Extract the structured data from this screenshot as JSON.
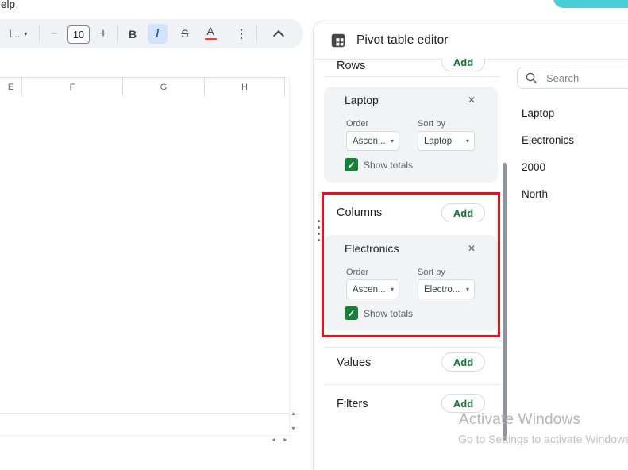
{
  "menubar": {
    "help_fragment": "elp"
  },
  "toolbar": {
    "font_family_value": "l...",
    "decrease_icon": "−",
    "font_size_value": "10",
    "increase_icon": "+",
    "bold_label": "B",
    "italic_label": "I",
    "strikethrough_label": "S",
    "text_color_label": "A"
  },
  "icons": {
    "caret": "▾",
    "close": "✕",
    "check": "✓",
    "more_vertical": "⋮",
    "arrow_up": "▲",
    "arrow_down": "▼",
    "arrow_left": "◄",
    "arrow_right": "►"
  },
  "sheet": {
    "column_headers": [
      "E",
      "F",
      "G",
      "H"
    ]
  },
  "pivot": {
    "title": "Pivot table editor",
    "rows": {
      "label": "Rows",
      "add_label": "Add"
    },
    "columns": {
      "label": "Columns",
      "add_label": "Add"
    },
    "values": {
      "label": "Values",
      "add_label": "Add"
    },
    "filters": {
      "label": "Filters",
      "add_label": "Add"
    },
    "rows_card": {
      "title": "Laptop",
      "order_label": "Order",
      "order_value": "Ascen...",
      "sortby_label": "Sort by",
      "sortby_value": "Laptop",
      "show_totals_label": "Show totals",
      "show_totals_checked": true
    },
    "columns_card": {
      "title": "Electronics",
      "order_label": "Order",
      "order_value": "Ascen...",
      "sortby_label": "Sort by",
      "sortby_value": "Electro...",
      "show_totals_label": "Show totals",
      "show_totals_checked": true
    }
  },
  "fields": {
    "search_placeholder": "Search",
    "items": [
      "Laptop",
      "Electronics",
      "2000",
      "North"
    ]
  },
  "watermark": {
    "line1": "Activate Windows",
    "line2": "Go to Settings to activate Windows"
  },
  "colors": {
    "add_button_green": "#137333",
    "checkbox_green": "#188038",
    "highlight_red": "#e8101c",
    "italic_active_blue": "#d3e3fd",
    "text_color_red": "#e94335",
    "share_button_teal": "#49ced8"
  }
}
